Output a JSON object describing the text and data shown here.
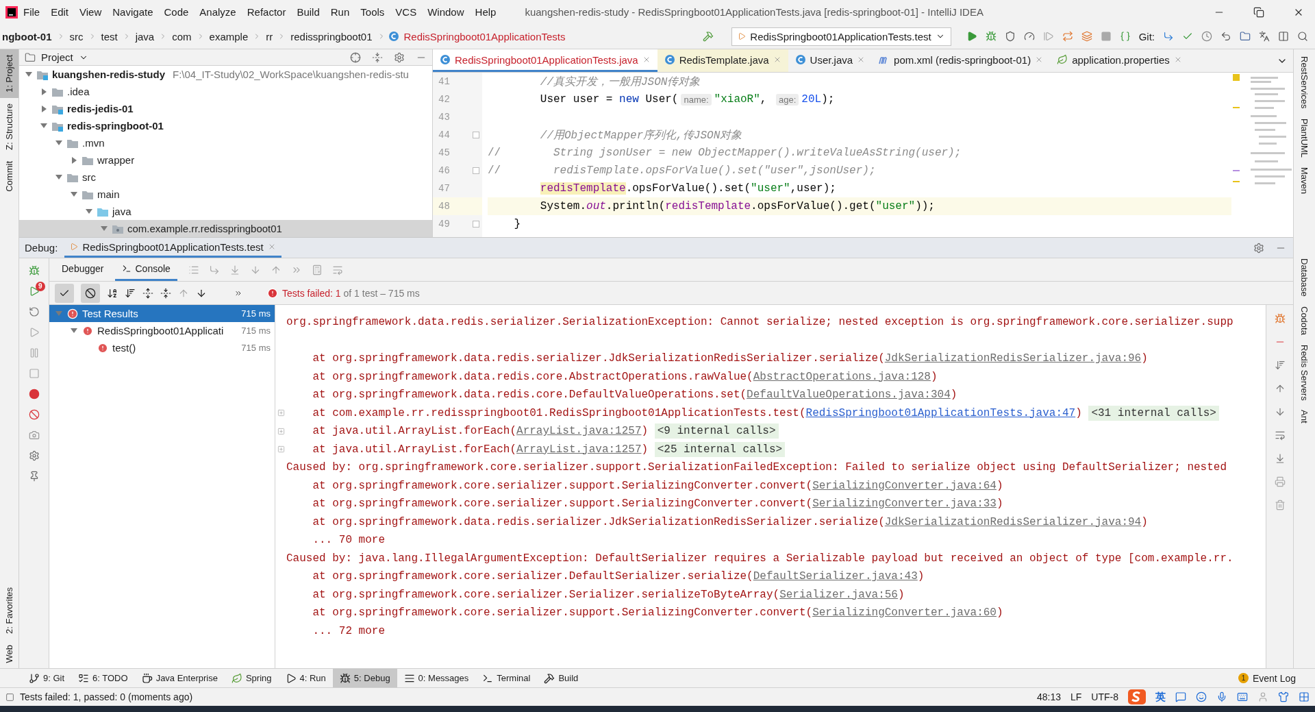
{
  "menu": [
    "File",
    "Edit",
    "View",
    "Navigate",
    "Code",
    "Analyze",
    "Refactor",
    "Build",
    "Run",
    "Tools",
    "VCS",
    "Window",
    "Help"
  ],
  "window": {
    "title": "kuangshen-redis-study - RedisSpringboot01ApplicationTests.java [redis-springboot-01] - IntelliJ IDEA"
  },
  "breadcrumbs": [
    {
      "label": "ngboot-01",
      "kind": "module"
    },
    {
      "label": "src",
      "kind": "folder"
    },
    {
      "label": "test",
      "kind": "folder"
    },
    {
      "label": "java",
      "kind": "folder"
    },
    {
      "label": "com",
      "kind": "folder"
    },
    {
      "label": "example",
      "kind": "folder"
    },
    {
      "label": "rr",
      "kind": "folder"
    },
    {
      "label": "redisspringboot01",
      "kind": "folder"
    },
    {
      "label": "RedisSpringboot01ApplicationTests",
      "kind": "class"
    }
  ],
  "run_config": {
    "label": "RedisSpringboot01ApplicationTests.test"
  },
  "git_label": "Git:",
  "left_tool_tabs": [
    {
      "label": "1: Project",
      "selected": true
    },
    {
      "label": "Z: Structure",
      "selected": false
    },
    {
      "label": "Commit",
      "selected": false
    }
  ],
  "left_tool_tabs_bottom": [
    {
      "label": "2: Favorites"
    },
    {
      "label": "Web"
    }
  ],
  "right_tool_tabs_top": [
    {
      "label": "RestServices"
    },
    {
      "label": "PlantUML"
    },
    {
      "label": "Maven"
    }
  ],
  "right_tool_tabs_bottom": [
    {
      "label": "Database"
    },
    {
      "label": "Codota"
    },
    {
      "label": "Redis Servers"
    },
    {
      "label": "Ant"
    }
  ],
  "project": {
    "title": "Project",
    "tree": [
      {
        "label": "kuangshen-redis-study",
        "kind": "module",
        "path": "F:\\04_IT-Study\\02_WorkSpace\\kuangshen-redis-stu",
        "expanded": true,
        "selected": false,
        "children": [
          {
            "label": ".idea",
            "kind": "folder",
            "expanded": false,
            "selected": false
          },
          {
            "label": "redis-jedis-01",
            "kind": "module",
            "expanded": false,
            "selected": false
          },
          {
            "label": "redis-springboot-01",
            "kind": "module",
            "expanded": true,
            "selected": false,
            "children": [
              {
                "label": ".mvn",
                "kind": "folder",
                "expanded": true,
                "selected": false,
                "children": [
                  {
                    "label": "wrapper",
                    "kind": "folder",
                    "expanded": false,
                    "selected": false
                  }
                ]
              },
              {
                "label": "src",
                "kind": "folder",
                "expanded": true,
                "selected": false,
                "children": [
                  {
                    "label": "main",
                    "kind": "folder",
                    "expanded": true,
                    "selected": false,
                    "children": [
                      {
                        "label": "java",
                        "kind": "source",
                        "expanded": true,
                        "selected": false,
                        "children": [
                          {
                            "label": "com.example.rr.redisspringboot01",
                            "kind": "package",
                            "expanded": true,
                            "selected": true
                          }
                        ]
                      }
                    ]
                  }
                ]
              }
            ]
          }
        ]
      }
    ]
  },
  "editor": {
    "tabs": [
      {
        "label": "RedisSpringboot01ApplicationTests.java",
        "kind": "test-class",
        "selected": true
      },
      {
        "label": "RedisTemplate.java",
        "kind": "library-class",
        "selected": false
      },
      {
        "label": "User.java",
        "kind": "class",
        "selected": false
      },
      {
        "label": "pom.xml (redis-springboot-01)",
        "kind": "maven",
        "selected": false
      },
      {
        "label": "application.properties",
        "kind": "properties",
        "selected": false
      }
    ],
    "lines": [
      {
        "number": "41",
        "fold": false,
        "current": false,
        "tokens": [
          {
            "text": "        //真实开发，一般用JSON传对象",
            "kind": "comment"
          }
        ]
      },
      {
        "number": "42",
        "fold": false,
        "current": false,
        "tokens": [
          {
            "text": "        User user = ",
            "kind": "plain"
          },
          {
            "text": "new",
            "kind": "keyword"
          },
          {
            "text": " User(",
            "kind": "plain"
          },
          {
            "text": "name:",
            "kind": "hint"
          },
          {
            "text": "\"xiaoR\"",
            "kind": "string"
          },
          {
            "text": ", ",
            "kind": "plain"
          },
          {
            "text": "age:",
            "kind": "hint"
          },
          {
            "text": "20L",
            "kind": "number"
          },
          {
            "text": ");",
            "kind": "plain"
          }
        ]
      },
      {
        "number": "43",
        "fold": false,
        "current": false
      },
      {
        "number": "44",
        "fold": true,
        "current": false,
        "tokens": [
          {
            "text": "        //用ObjectMapper序列化,传JSON对象",
            "kind": "comment"
          }
        ]
      },
      {
        "number": "45",
        "fold": false,
        "current": false,
        "tokens": [
          {
            "text": "//",
            "kind": "marker"
          },
          {
            "text": "        String jsonUser = new ObjectMapper().writeValueAsString(user);",
            "kind": "comment"
          }
        ]
      },
      {
        "number": "46",
        "fold": true,
        "current": false,
        "tokens": [
          {
            "text": "//",
            "kind": "marker"
          },
          {
            "text": "        redisTemplate.opsForValue().set(\"user\",jsonUser);",
            "kind": "comment"
          }
        ]
      },
      {
        "number": "47",
        "fold": false,
        "current": false,
        "tokens": [
          {
            "text": "        redisTemplate",
            "kind": "field-highlight"
          },
          {
            "text": ".opsForValue().set(",
            "kind": "plain"
          },
          {
            "text": "\"user\"",
            "kind": "string"
          },
          {
            "text": ",user);",
            "kind": "plain"
          }
        ]
      },
      {
        "number": "48",
        "fold": false,
        "current": true,
        "tokens": [
          {
            "text": "        System.",
            "kind": "plain"
          },
          {
            "text": "out",
            "kind": "static"
          },
          {
            "text": ".println(",
            "kind": "plain"
          },
          {
            "text": "redisTemplate",
            "kind": "field"
          },
          {
            "text": ".opsForValue().get(",
            "kind": "plain"
          },
          {
            "text": "\"user\"",
            "kind": "string"
          },
          {
            "text": "));",
            "kind": "plain"
          }
        ]
      },
      {
        "number": "49",
        "fold": true,
        "current": false,
        "tokens": [
          {
            "text": "    }",
            "kind": "plain"
          }
        ]
      }
    ]
  },
  "debug": {
    "label": "Debug:",
    "tab": {
      "label": "RedisSpringboot01ApplicationTests.test"
    },
    "rerun_badge": "9",
    "subtabs": [
      {
        "label": "Debugger",
        "selected": false
      },
      {
        "label": "Console",
        "selected": true
      }
    ],
    "toggles": [
      {
        "kind": "passed",
        "on": true
      },
      {
        "kind": "ignored",
        "on": true
      }
    ],
    "status": {
      "failed": "Tests failed: 1",
      "detail": "of 1 test – 715 ms"
    },
    "tests": [
      {
        "label": "Test Results",
        "time": "715 ms",
        "expanded": true,
        "selected": true,
        "children": [
          {
            "label": "RedisSpringboot01Applicati",
            "time": "715 ms",
            "expanded": true,
            "selected": false,
            "children": [
              {
                "label": "test()",
                "time": "715 ms",
                "selected": false
              }
            ]
          }
        ]
      }
    ]
  },
  "console": {
    "lines": [
      {
        "kind": "message",
        "foldable": false,
        "blank_after": true,
        "segments": [
          {
            "kind": "text",
            "text": "org.springframework.data.redis.serializer.SerializationException: Cannot serialize; nested exception is org.springframework.core.serializer.supp"
          }
        ]
      },
      {
        "kind": "frame",
        "foldable": false,
        "blank_after": false,
        "segments": [
          {
            "kind": "text",
            "text": "at org.springframework.data.redis.serializer.JdkSerializationRedisSerializer.serialize("
          },
          {
            "kind": "link",
            "text": "JdkSerializationRedisSerializer.java:96"
          },
          {
            "kind": "text",
            "text": ")"
          }
        ]
      },
      {
        "kind": "frame",
        "foldable": false,
        "blank_after": false,
        "segments": [
          {
            "kind": "text",
            "text": "at org.springframework.data.redis.core.AbstractOperations.rawValue("
          },
          {
            "kind": "link",
            "text": "AbstractOperations.java:128"
          },
          {
            "kind": "text",
            "text": ")"
          }
        ]
      },
      {
        "kind": "frame",
        "foldable": false,
        "blank_after": false,
        "segments": [
          {
            "kind": "text",
            "text": "at org.springframework.data.redis.core.DefaultValueOperations.set("
          },
          {
            "kind": "link",
            "text": "DefaultValueOperations.java:304"
          },
          {
            "kind": "text",
            "text": ")"
          }
        ]
      },
      {
        "kind": "frame",
        "foldable": true,
        "blank_after": false,
        "segments": [
          {
            "kind": "text",
            "text": "at com.example.rr.redisspringboot01.RedisSpringboot01ApplicationTests.test("
          },
          {
            "kind": "link-active",
            "text": "RedisSpringboot01ApplicationTests.java:47"
          },
          {
            "kind": "text",
            "text": ") "
          },
          {
            "kind": "internal",
            "text": "<31 internal calls>"
          }
        ]
      },
      {
        "kind": "frame",
        "foldable": true,
        "blank_after": false,
        "segments": [
          {
            "kind": "text",
            "text": "at java.util.ArrayList.forEach("
          },
          {
            "kind": "link",
            "text": "ArrayList.java:1257"
          },
          {
            "kind": "text",
            "text": ") "
          },
          {
            "kind": "internal",
            "text": "<9 internal calls>"
          }
        ]
      },
      {
        "kind": "frame",
        "foldable": true,
        "blank_after": false,
        "segments": [
          {
            "kind": "text",
            "text": "at java.util.ArrayList.forEach("
          },
          {
            "kind": "link",
            "text": "ArrayList.java:1257"
          },
          {
            "kind": "text",
            "text": ") "
          },
          {
            "kind": "internal",
            "text": "<25 internal calls>"
          }
        ]
      },
      {
        "kind": "message",
        "foldable": false,
        "blank_after": false,
        "segments": [
          {
            "kind": "text",
            "text": "Caused by: org.springframework.core.serializer.support.SerializationFailedException: Failed to serialize object using DefaultSerializer; nested"
          }
        ]
      },
      {
        "kind": "frame",
        "foldable": false,
        "blank_after": false,
        "segments": [
          {
            "kind": "text",
            "text": "at org.springframework.core.serializer.support.SerializingConverter.convert("
          },
          {
            "kind": "link",
            "text": "SerializingConverter.java:64"
          },
          {
            "kind": "text",
            "text": ")"
          }
        ]
      },
      {
        "kind": "frame",
        "foldable": false,
        "blank_after": false,
        "segments": [
          {
            "kind": "text",
            "text": "at org.springframework.core.serializer.support.SerializingConverter.convert("
          },
          {
            "kind": "link",
            "text": "SerializingConverter.java:33"
          },
          {
            "kind": "text",
            "text": ")"
          }
        ]
      },
      {
        "kind": "frame",
        "foldable": false,
        "blank_after": false,
        "segments": [
          {
            "kind": "text",
            "text": "at org.springframework.data.redis.serializer.JdkSerializationRedisSerializer.serialize("
          },
          {
            "kind": "link",
            "text": "JdkSerializationRedisSerializer.java:94"
          },
          {
            "kind": "text",
            "text": ")"
          }
        ]
      },
      {
        "kind": "frame",
        "foldable": false,
        "blank_after": false,
        "segments": [
          {
            "kind": "text",
            "text": "... 70 more"
          }
        ]
      },
      {
        "kind": "message",
        "foldable": false,
        "blank_after": false,
        "segments": [
          {
            "kind": "text",
            "text": "Caused by: java.lang.IllegalArgumentException: DefaultSerializer requires a Serializable payload but received an object of type [com.example.rr."
          }
        ]
      },
      {
        "kind": "frame",
        "foldable": false,
        "blank_after": false,
        "segments": [
          {
            "kind": "text",
            "text": "at org.springframework.core.serializer.DefaultSerializer.serialize("
          },
          {
            "kind": "link",
            "text": "DefaultSerializer.java:43"
          },
          {
            "kind": "text",
            "text": ")"
          }
        ]
      },
      {
        "kind": "frame",
        "foldable": false,
        "blank_after": false,
        "segments": [
          {
            "kind": "text",
            "text": "at org.springframework.core.serializer.Serializer.serializeToByteArray("
          },
          {
            "kind": "link",
            "text": "Serializer.java:56"
          },
          {
            "kind": "text",
            "text": ")"
          }
        ]
      },
      {
        "kind": "frame",
        "foldable": false,
        "blank_after": false,
        "segments": [
          {
            "kind": "text",
            "text": "at org.springframework.core.serializer.support.SerializingConverter.convert("
          },
          {
            "kind": "link",
            "text": "SerializingConverter.java:60"
          },
          {
            "kind": "text",
            "text": ")"
          }
        ]
      },
      {
        "kind": "frame",
        "foldable": false,
        "blank_after": false,
        "segments": [
          {
            "kind": "text",
            "text": "... 72 more"
          }
        ]
      }
    ]
  },
  "bottom_tools": [
    {
      "label": "9: Git",
      "kind": "git",
      "selected": false
    },
    {
      "label": "6: TODO",
      "kind": "todo",
      "selected": false
    },
    {
      "label": "Java Enterprise",
      "kind": "enterprise",
      "selected": false
    },
    {
      "label": "Spring",
      "kind": "spring",
      "selected": false
    },
    {
      "label": "4: Run",
      "kind": "run",
      "selected": false
    },
    {
      "label": "5: Debug",
      "kind": "debug",
      "selected": true
    },
    {
      "label": "0: Messages",
      "kind": "messages",
      "selected": false
    },
    {
      "label": "Terminal",
      "kind": "terminal",
      "selected": false
    },
    {
      "label": "Build",
      "kind": "build",
      "selected": false
    }
  ],
  "event_log": {
    "label": "Event Log",
    "badge": "1"
  },
  "status_bar": {
    "message": "Tests failed: 1, passed: 0 (moments ago)",
    "position": "48:13",
    "line_separator": "LF",
    "encoding": "UTF-8",
    "ime_language": "英"
  }
}
